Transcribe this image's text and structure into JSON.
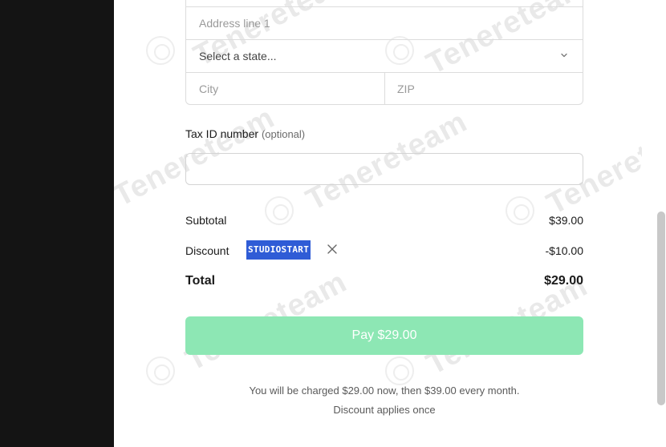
{
  "address": {
    "line1_placeholder": "Address line 1",
    "state_placeholder": "Select a state...",
    "city_placeholder": "City",
    "zip_placeholder": "ZIP"
  },
  "tax": {
    "label": "Tax ID number",
    "optional": "(optional)",
    "value": ""
  },
  "summary": {
    "subtotal_label": "Subtotal",
    "subtotal_amount": "$39.00",
    "discount_label": "Discount",
    "discount_code": "STUDIOSTART",
    "discount_amount": "-$10.00",
    "total_label": "Total",
    "total_amount": "$29.00"
  },
  "pay_button": {
    "label": "Pay $29.00",
    "color": "#8de7b4"
  },
  "notes": {
    "charge": "You will be charged $29.00 now, then $39.00 every month.",
    "discount": "Discount applies once"
  },
  "watermark": {
    "text": "Tenereteam"
  },
  "colors": {
    "coupon_bg": "#2f5cd6",
    "left_panel": "#141414"
  }
}
